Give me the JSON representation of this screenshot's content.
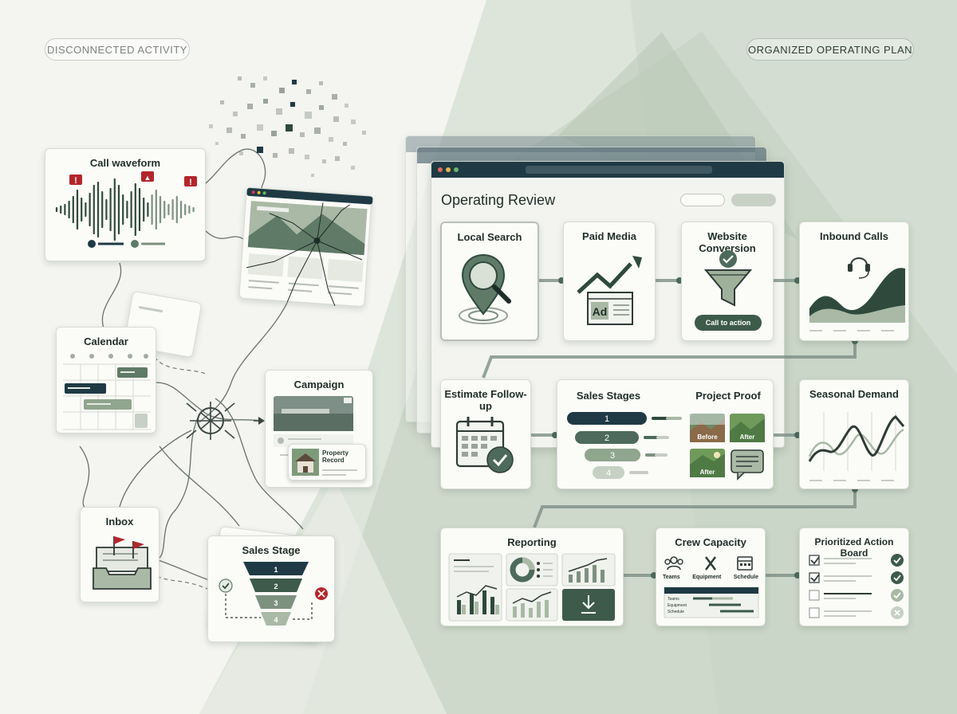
{
  "labels": {
    "left_pill": "DISCONNECTED ACTIVITY",
    "right_pill": "ORGANIZED OPERATING PLAN"
  },
  "left": {
    "call_waveform": {
      "title": "Call waveform"
    },
    "calendar": {
      "title": "Calendar"
    },
    "campaign": {
      "title": "Campaign",
      "property_record": "Property Record"
    },
    "inbox": {
      "title": "Inbox"
    },
    "sales_stage": {
      "title": "Sales Stage",
      "stages": [
        "1",
        "2",
        "3",
        "4"
      ]
    }
  },
  "right": {
    "window_title": "Operating Review",
    "local_search": {
      "title": "Local Search"
    },
    "paid_media": {
      "title": "Paid Media",
      "ad_label": "Ad"
    },
    "website_conversion": {
      "title": "Website Conversion",
      "cta": "Call to action"
    },
    "inbound_calls": {
      "title": "Inbound Calls"
    },
    "estimate_followup": {
      "title": "Estimate Follow-up"
    },
    "sales_stages": {
      "title": "Sales Stages",
      "stages": [
        "1",
        "2",
        "3",
        "4"
      ]
    },
    "project_proof": {
      "title": "Project Proof",
      "before": "Before",
      "after": "After",
      "after2": "After"
    },
    "seasonal_demand": {
      "title": "Seasonal Demand"
    },
    "reporting": {
      "title": "Reporting"
    },
    "crew_capacity": {
      "title": "Crew Capacity",
      "icons": [
        "Teams",
        "Equipment",
        "Schedule"
      ],
      "rows": [
        "Teams",
        "Equipment",
        "Schedule"
      ]
    },
    "action_board": {
      "title": "Prioritized Action Board"
    }
  },
  "colors": {
    "dark_green": "#2f4a3c",
    "mid_green": "#5f7a66",
    "light_green": "#a9b9a5",
    "navy": "#1f3a44",
    "alert_red": "#b3262b"
  }
}
